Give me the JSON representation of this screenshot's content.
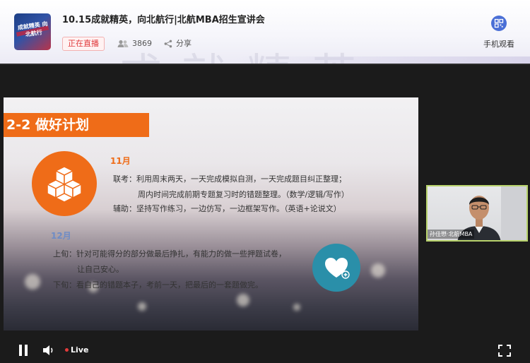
{
  "header": {
    "logo_text": "成就精英 向北航行",
    "title": "10.15成就精英，向北航行|北航MBA招生宣讲会",
    "live_badge": "正在直播",
    "viewer_count": "3869",
    "share_label": "分享",
    "mobile_label": "手机观看",
    "background_art_text": "成就精英"
  },
  "slide": {
    "section_title": "2-2  做好计划",
    "november": {
      "month": "11月",
      "lines": [
        "联考：利用周末两天，一天完成模拟自测，一天完成题目纠正整理；",
        "周内时间完成前期专题复习时的错题整理。（数学/逻辑/写作）",
        "辅助：坚持写作练习，一边仿写，一边框架写作。（英语+论说文）"
      ]
    },
    "december": {
      "month": "12月",
      "lines": [
        "上旬：针对可能得分的部分做最后挣扎，有能力的做一些押题试卷，",
        "让自己安心。",
        "下旬：看自己的错题本子，考前一天，把最后的一套题做完。"
      ]
    }
  },
  "camera": {
    "label": "孙佳懋·北航MBA"
  },
  "controls": {
    "live_label": "Live"
  },
  "colors": {
    "accent_orange": "#ef6c18",
    "teal_circle": "#2a8fa9",
    "live_red": "#e0393b",
    "camera_border": "#b8d36c",
    "mobile_icon_blue": "#4a6fd6"
  },
  "icons": [
    "people-icon",
    "share-icon",
    "qr-code-icon",
    "blocks-icon",
    "heart-icon",
    "play-pause-icon",
    "volume-icon",
    "fullscreen-icon"
  ]
}
